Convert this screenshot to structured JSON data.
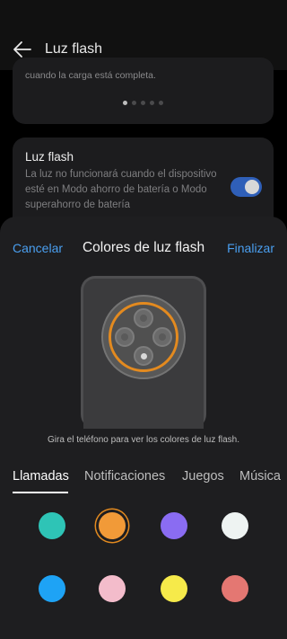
{
  "header": {
    "title": "Luz flash",
    "back_icon": "back-arrow-icon"
  },
  "charge_card": {
    "note": "cuando la carga está completa.",
    "dots_total": 5,
    "dots_active_index": 0
  },
  "flash_setting": {
    "title": "Luz flash",
    "description": "La luz no funcionará cuando el dispositivo esté en Modo ahorro de batería o Modo superahorro de batería",
    "toggle_on": true
  },
  "sheet": {
    "cancel_label": "Cancelar",
    "title": "Colores de luz flash",
    "done_label": "Finalizar",
    "hint": "Gira el teléfono para ver los colores de luz flash.",
    "tabs": [
      "Llamadas",
      "Notificaciones",
      "Juegos",
      "Música"
    ],
    "active_tab": 0,
    "accent_color": "#e38a1f",
    "link_color": "#4a9ff0"
  },
  "colors": [
    "#2ec4b6",
    "#f19a38",
    "#8a6cf2",
    "#eef3f2",
    "#1ea3f5",
    "#f3bccb",
    "#f6ea4a",
    "#e47772"
  ],
  "selected_color_index": 1
}
